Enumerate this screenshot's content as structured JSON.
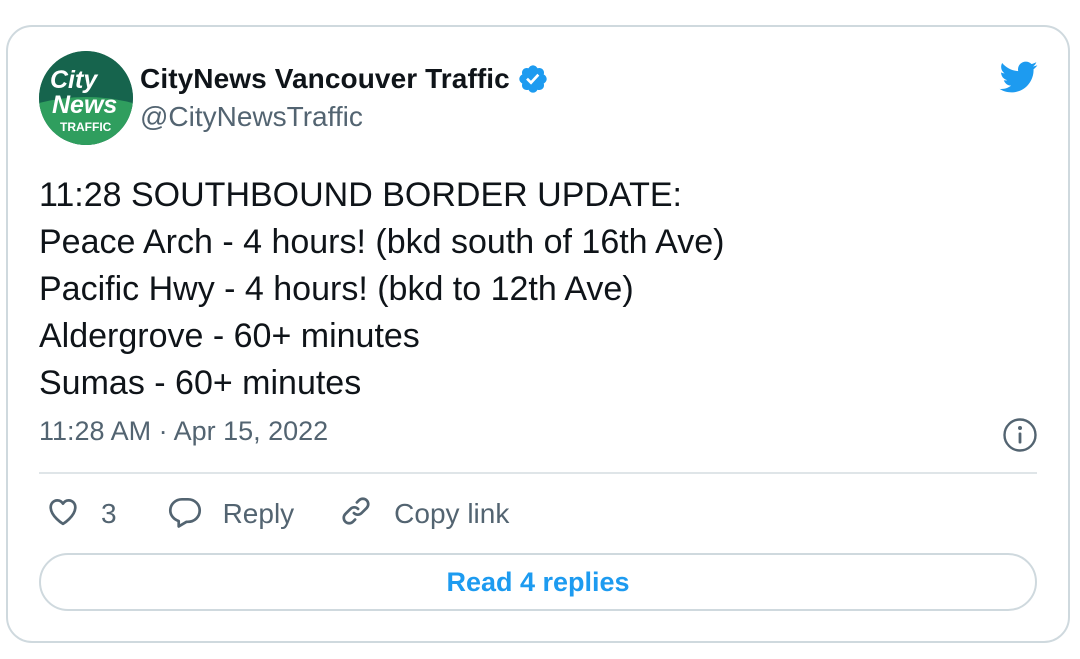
{
  "tweet": {
    "author": {
      "display_name": "CityNews Vancouver Traffic",
      "handle": "@CityNewsTraffic",
      "avatar_lines": [
        "City",
        "News",
        "TRAFFIC"
      ],
      "verified": true
    },
    "body_lines": [
      "11:28 SOUTHBOUND BORDER UPDATE:",
      "Peace Arch - 4 hours! (bkd south of 16th Ave)",
      "Pacific Hwy - 4 hours! (bkd to 12th Ave)",
      "Aldergrove - 60+ minutes",
      "Sumas - 60+ minutes"
    ],
    "timestamp": "11:28 AM · Apr 15, 2022",
    "actions": {
      "like_count": "3",
      "reply_label": "Reply",
      "copy_link_label": "Copy link"
    },
    "read_replies_label": "Read 4 replies"
  },
  "icons": {
    "brand": "twitter-bird-icon",
    "verified": "verified-badge-icon",
    "info": "info-icon",
    "like": "heart-icon",
    "reply": "speech-bubble-icon",
    "copy_link": "link-icon"
  },
  "colors": {
    "accent": "#1d9bf0",
    "text_primary": "#0f1419",
    "text_secondary": "#536471",
    "border": "#cfd9de",
    "avatar_bg": "#16644d"
  }
}
